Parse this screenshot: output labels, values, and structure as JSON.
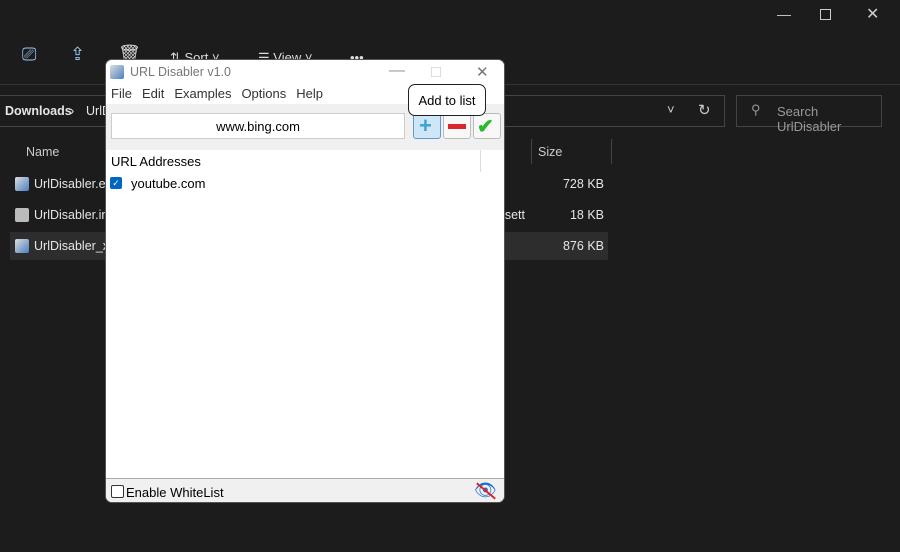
{
  "explorer": {
    "toolbar": {
      "sort": "Sort",
      "view": "View",
      "more": "•••"
    },
    "breadcrumb": [
      "Downloads",
      "UrlDisabler"
    ],
    "search_placeholder": "Search UrlDisabler",
    "columns": {
      "name": "Name",
      "size": "Size"
    },
    "files": [
      {
        "name": "UrlDisabler.exe",
        "type": "",
        "size": "728 KB"
      },
      {
        "name": "UrlDisabler.ini",
        "type": "Configuration sett...",
        "size": "18 KB"
      },
      {
        "name": "UrlDisabler_x64.exe",
        "type": "",
        "size": "876 KB"
      }
    ]
  },
  "dialog": {
    "title": "URL Disabler v1.0",
    "menu": [
      "File",
      "Edit",
      "Examples",
      "Options",
      "Help"
    ],
    "url_value": "www.bing.com",
    "tooltip": "Add to list",
    "list_header": "URL Addresses",
    "items": [
      {
        "label": "youtube.com",
        "checked": true
      }
    ],
    "whitelist_label": "Enable WhiteList",
    "whitelist_checked": false
  }
}
